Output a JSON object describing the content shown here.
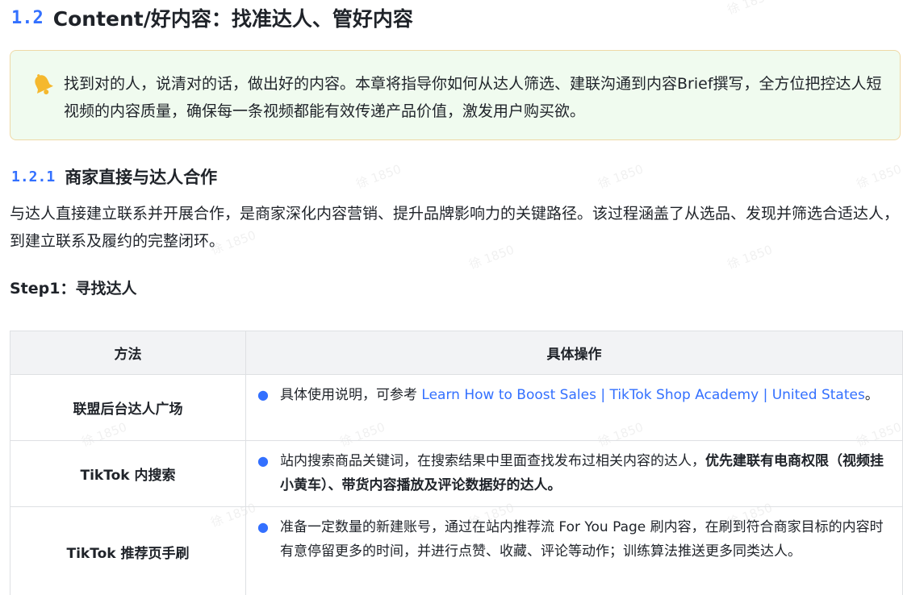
{
  "watermark": "徐 1850",
  "heading": {
    "number": "1.2",
    "title": "Content/好内容：找准达人、管好内容"
  },
  "callout": {
    "icon": "bell-icon",
    "text": "找到对的人，说清对的话，做出好的内容。本章将指导你如何从达人筛选、建联沟通到内容Brief撰写，全方位把控达人短视频的内容质量，确保每一条视频都能有效传递产品价值，激发用户购买欲。",
    "bg_color": "#f0fbef",
    "border_color": "#eed9a6"
  },
  "subheading": {
    "number": "1.2.1",
    "title": "商家直接与达人合作"
  },
  "paragraph": "与达人直接建立联系并开展合作，是商家深化内容营销、提升品牌影响力的关键路径。该过程涵盖了从选品、发现并筛选合适达人，到建立联系及履约的完整闭环。",
  "step_title": "Step1：寻找达人",
  "table": {
    "headers": [
      "方法",
      "具体操作"
    ],
    "rows": [
      {
        "method": "联盟后台达人广场",
        "text_before": "具体使用说明，可参考 ",
        "link": "Learn How to Boost Sales | TikTok Shop Academy | United States",
        "text_after": "。"
      },
      {
        "method": "TikTok 内搜索",
        "text_before": "站内搜索商品关键词，在搜索结果中里面查找发布过相关内容的达人，",
        "bold": "优先建联有电商权限（视频挂小黄车）、带货内容播放及评论数据好的达人。"
      },
      {
        "method": "TikTok 推荐页手刷",
        "text_before": "准备一定数量的新建账号，通过在站内推荐流 For You Page 刷内容，在刷到符合商家目标的内容时有意停留更多的时间，并进行点赞、收藏、评论等动作；训练算法推送更多同类达人。"
      }
    ]
  },
  "colors": {
    "accent": "#3370ff",
    "text": "#1f2329",
    "table_header_bg": "#f2f3f5",
    "table_border": "#dee0e3"
  }
}
